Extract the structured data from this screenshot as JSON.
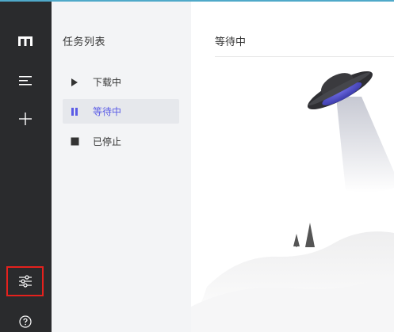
{
  "sidebar": {
    "icons": [
      "logo-icon",
      "menu-icon",
      "plus-icon",
      "settings-sliders-icon",
      "help-icon"
    ]
  },
  "task_panel": {
    "title": "任务列表",
    "items": [
      {
        "label": "下载中",
        "icon": "play-icon",
        "active": false
      },
      {
        "label": "等待中",
        "icon": "pause-icon",
        "active": true
      },
      {
        "label": "已停止",
        "icon": "stop-icon",
        "active": false
      }
    ]
  },
  "main": {
    "header": "等待中"
  },
  "colors": {
    "rail": "#2a2b2d",
    "panel": "#f3f4f6",
    "accent": "#5b5ce6",
    "highlight": "#e5211d"
  }
}
